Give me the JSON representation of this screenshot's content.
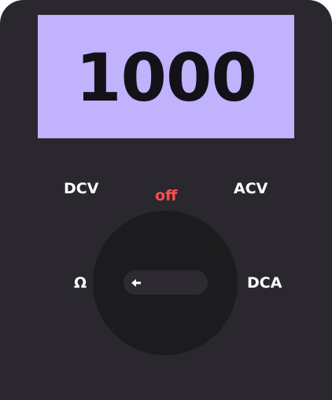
{
  "display": {
    "value": "1000"
  },
  "dial": {
    "labels": {
      "dcv": "DCV",
      "off": "off",
      "acv": "ACV",
      "ohm": "Ω",
      "dca": "DCA"
    },
    "selected": "Ω",
    "pointer_icon": "arrow-left-icon"
  },
  "colors": {
    "body": "#2a272e",
    "display_bg": "#c0b2fc",
    "display_text": "#141218",
    "dial": "#1c1c1e",
    "pointer": "#2d2b31",
    "label": "#ffffff",
    "off_label": "#ff4d4d"
  }
}
